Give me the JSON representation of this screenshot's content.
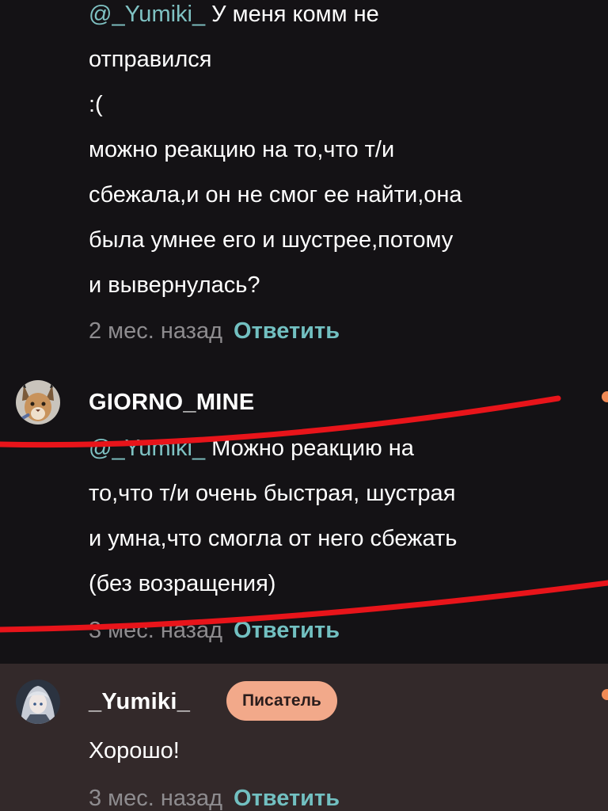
{
  "comments": [
    {
      "mention": "@_Yumiki_",
      "text": " У меня комм не\nотправился\n:(\nможно реакцию на то,что т/и\nсбежала,и он не смог ее найти,она\nбыла умнее его и шустрее,потому\nи вывернулась?",
      "time": "2 мес. назад",
      "reply": "Ответить"
    },
    {
      "username": "GIORNO_MINE",
      "mention": "@_Yumiki_",
      "text": " Можно реакцию на\nто,что т/и очень быстрая, шустрая\nи умна,что смогла от него сбежать\n(без возращения)",
      "time": "3 мес. назад",
      "reply": "Ответить"
    },
    {
      "username": "_Yumiki_",
      "badge": "Писатель",
      "text": "Хорошо!",
      "time": "3 мес. назад",
      "reply": "Ответить"
    }
  ],
  "colors": {
    "mention": "#7fc2c3",
    "reply": "#72c0c1",
    "badge": "#f2a98a",
    "highlight_background": "#33292a",
    "annotation_line": "#e8141a"
  },
  "icons": {
    "avatar_1": "caracal-avatar",
    "avatar_2": "anime-girl-avatar",
    "annotation": "red-strike-lines"
  }
}
